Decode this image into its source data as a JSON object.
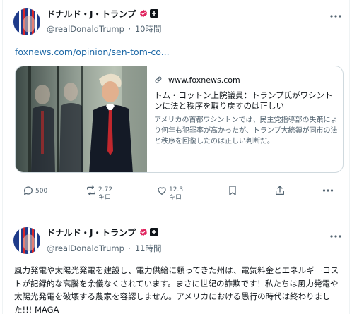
{
  "posts": [
    {
      "author": {
        "display_name": "ドナルド・J・トランプ",
        "handle": "@realDonaldTrump",
        "separator": "·",
        "time": "10時間"
      },
      "link_text": "foxnews.com/opinion/sen-tom-co...",
      "card": {
        "domain": "www.foxnews.com",
        "title": "トム・コットン上院議員：トランプ氏がワシントンに法と秩序を取り戻すのは正しい",
        "description": "アメリカの首都ワシントンでは、民主党指導部の失策により何年も犯罪率が高かったが、トランプ大統領が同市の法と秩序を回復したのは正しい判断だ。"
      },
      "actions": {
        "reply_count": "500",
        "repost_count": "2.72キロ",
        "like_count": "12.3キロ"
      }
    },
    {
      "author": {
        "display_name": "ドナルド・J・トランプ",
        "handle": "@realDonaldTrump",
        "separator": "·",
        "time": "11時間"
      },
      "text": "風力発電や太陽光発電を建設し、電力供給に頼ってきた州は、電気料金とエネルギーコストが記録的な高騰を余儀なくされています。まさに世紀の詐欺です！私たちは風力発電や太陽光発電を破壊する農家を容認しません。アメリカにおける愚行の時代は終わりました!!! MAGA"
    }
  ],
  "colors": {
    "link": "#1d68a6",
    "verified_badge": "#e0245e",
    "secondary_text": "#536471",
    "border": "#cfd9de"
  },
  "icons": [
    "avatar-flag-icon",
    "verified-badge-icon",
    "affiliate-badge-icon",
    "more-icon",
    "link-icon",
    "reply-icon",
    "repost-icon",
    "like-icon",
    "bookmark-icon",
    "share-icon"
  ]
}
